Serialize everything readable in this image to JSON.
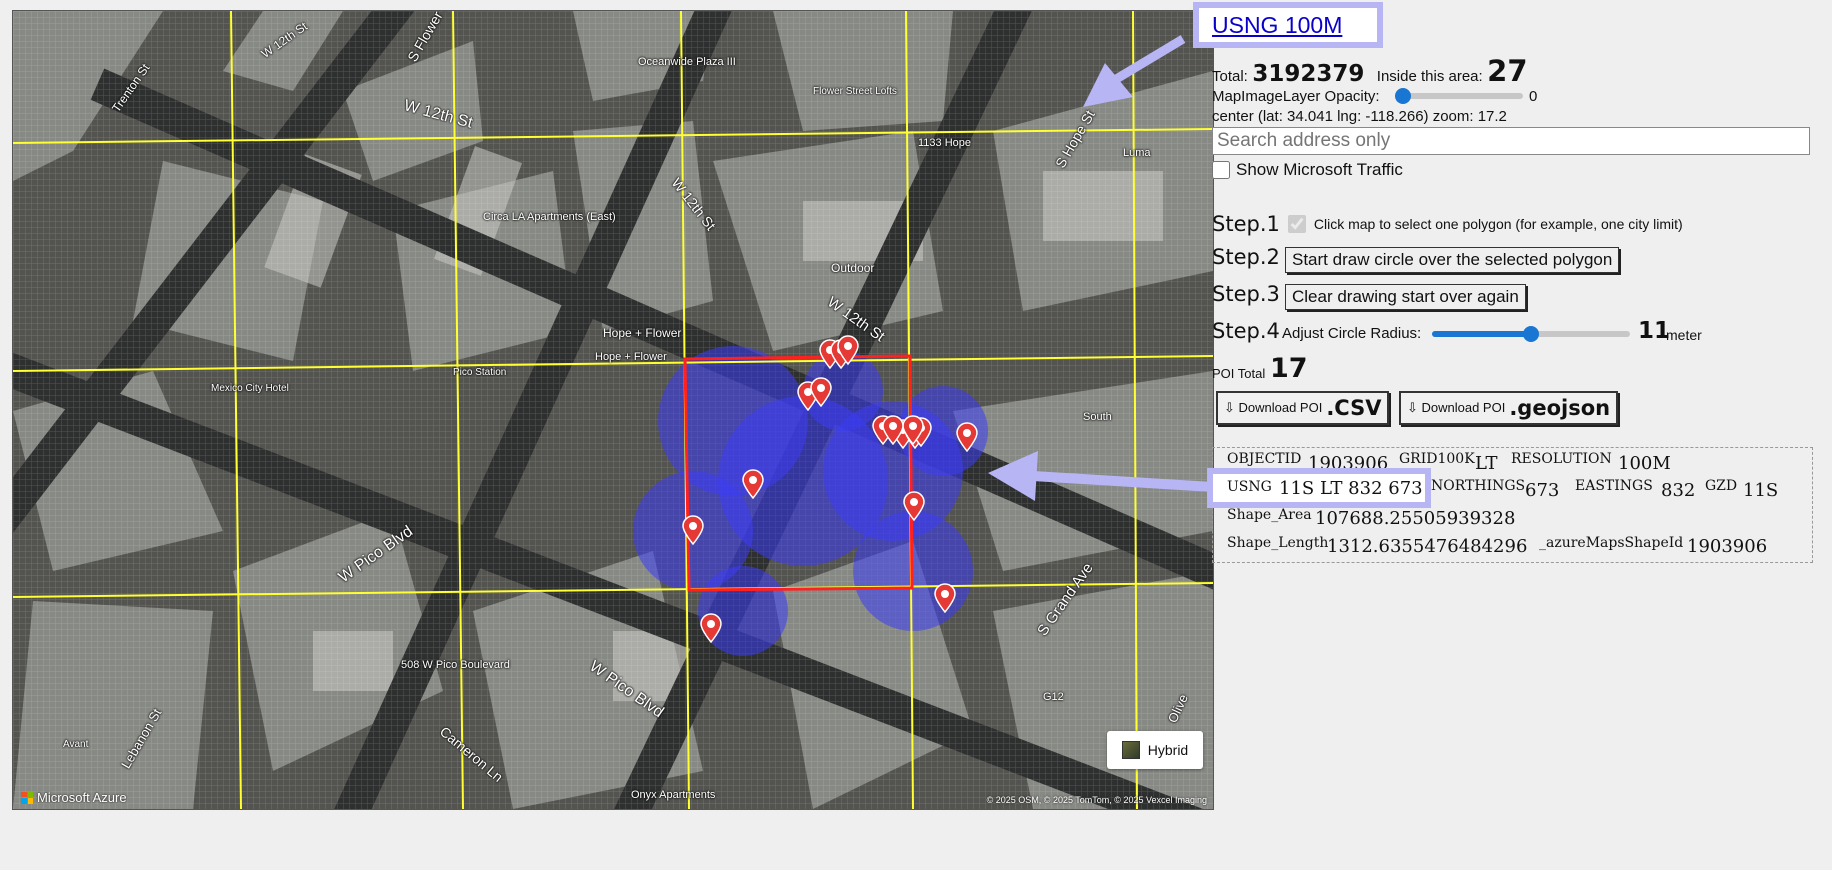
{
  "map": {
    "attribution": "Microsoft Azure",
    "copyright": "© 2025 OSM, © 2025 TomTom, © 2025 Vexcel Imaging",
    "style_button": "Hybrid",
    "labels": [
      {
        "text": "W 12th St"
      },
      {
        "text": "W 12th St"
      },
      {
        "text": "W 12th St"
      },
      {
        "text": "W 12th St"
      },
      {
        "text": "Trenton St"
      },
      {
        "text": "S Flower St"
      },
      {
        "text": "S Hope St"
      },
      {
        "text": "W Pico Blvd"
      },
      {
        "text": "W Pico Blvd"
      },
      {
        "text": "S Grand Ave"
      },
      {
        "text": "Cameron Ln"
      },
      {
        "text": "Oceanwide Plaza III"
      },
      {
        "text": "Circa LA Apartments (East)"
      },
      {
        "text": "Hope + Flower"
      },
      {
        "text": "Outdoor"
      },
      {
        "text": "1133 Hope"
      },
      {
        "text": "Luma"
      },
      {
        "text": "508 W Pico Boulevard"
      },
      {
        "text": "Hope + Flower"
      },
      {
        "text": "Pico Station"
      },
      {
        "text": "Mexico City Hotel"
      },
      {
        "text": "Onyx Apartments"
      },
      {
        "text": "G12"
      },
      {
        "text": "Flower Street Lofts"
      },
      {
        "text": "Lebanon St"
      },
      {
        "text": "Avant"
      },
      {
        "text": "South"
      },
      {
        "text": "Olive"
      }
    ],
    "marker_count": 17
  },
  "panel": {
    "layer_title": "USNG 100M",
    "total_label": "Total:",
    "total_value": "3192379",
    "inside_label": "Inside this area:",
    "inside_value": "27",
    "opacity_label": "MapImageLayer Opacity:",
    "opacity_value": "0",
    "opacity_fraction": 0,
    "center_text": "center (lat: 34.041 lng: -118.266) zoom: 17.2",
    "search_placeholder": "Search address only",
    "traffic_label": "Show Microsoft Traffic",
    "traffic_checked": false,
    "step1_label": "Step.1",
    "step1_text": "Click map to select one polygon (for example, one city limit)",
    "step1_checked": true,
    "step2_label": "Step.2",
    "step2_button": "Start draw circle over the selected polygon",
    "step3_label": "Step.3",
    "step3_button": "Clear drawing start over again",
    "step4_label": "Step.4",
    "step4_text": "Adjust Circle Radius:",
    "radius_value": "11",
    "radius_unit": "meter",
    "radius_fraction": 0.5,
    "poi_label": "POI Total",
    "poi_value": "17",
    "download_csv_small": "⇩ Download POI",
    "download_csv_big": ".CSV",
    "download_geojson_small": "⇩ Download POI",
    "download_geojson_big": ".geojson"
  },
  "attributes": {
    "objectid_key": "OBJECTID",
    "objectid_val": "1903906",
    "grid_key": "GRID100K",
    "grid_val": "LT",
    "resolution_key": "RESOLUTION",
    "resolution_val": "100M",
    "usng_key": "USNG",
    "usng_val": "11S LT 832 673",
    "northings_key": "NORTHINGS",
    "northings_val": "673",
    "eastings_key": "EASTINGS",
    "eastings_val": "832",
    "gzd_key": "GZD",
    "gzd_val": "11S",
    "area_key": "Shape_Area",
    "area_val": "107688.25505939328",
    "length_key": "Shape_Length",
    "length_val": "1312.6355476484296",
    "shapeid_key": "_azureMapsShapeId",
    "shapeid_val": "1903906"
  },
  "colors": {
    "grid_line": "#ffff33",
    "selected_cell": "#ff2020",
    "circle_fill": "#3333ff",
    "annotation": "#b8b5f4",
    "slider": "#1976d2",
    "link": "#0a00cc"
  }
}
